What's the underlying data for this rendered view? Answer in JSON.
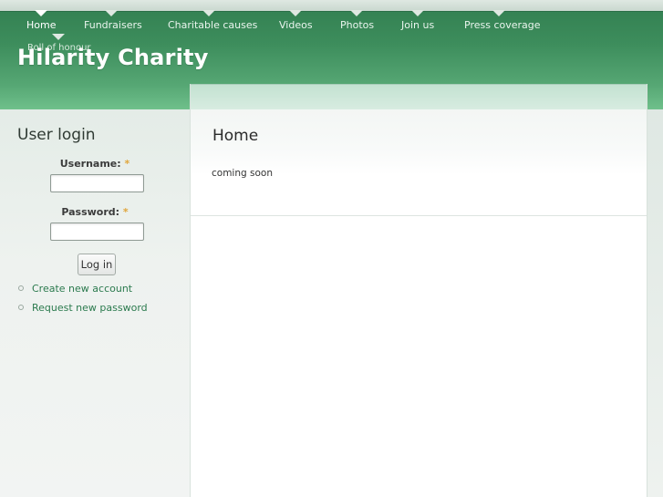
{
  "site": {
    "name": "Hilarity Charity"
  },
  "nav": {
    "items": [
      {
        "label": "Home",
        "active": true
      },
      {
        "label": "Fundraisers",
        "active": false
      },
      {
        "label": "Charitable causes",
        "active": false
      },
      {
        "label": "Videos",
        "active": false
      },
      {
        "label": "Photos",
        "active": false
      },
      {
        "label": "Join us",
        "active": false
      },
      {
        "label": "Press coverage",
        "active": false
      },
      {
        "label": "Roll of honour",
        "active": false
      }
    ]
  },
  "sidebar": {
    "block_title": "User login",
    "username_label": "Username:",
    "password_label": "Password:",
    "required_marker": "*",
    "login_button": "Log in",
    "links": [
      {
        "label": "Create new account"
      },
      {
        "label": "Request new password"
      }
    ]
  },
  "main": {
    "title": "Home",
    "body": "coming soon"
  },
  "colors": {
    "header_green": "#3d8d5c",
    "link_green": "#2b7a4e",
    "required_orange": "#e0a53c"
  }
}
